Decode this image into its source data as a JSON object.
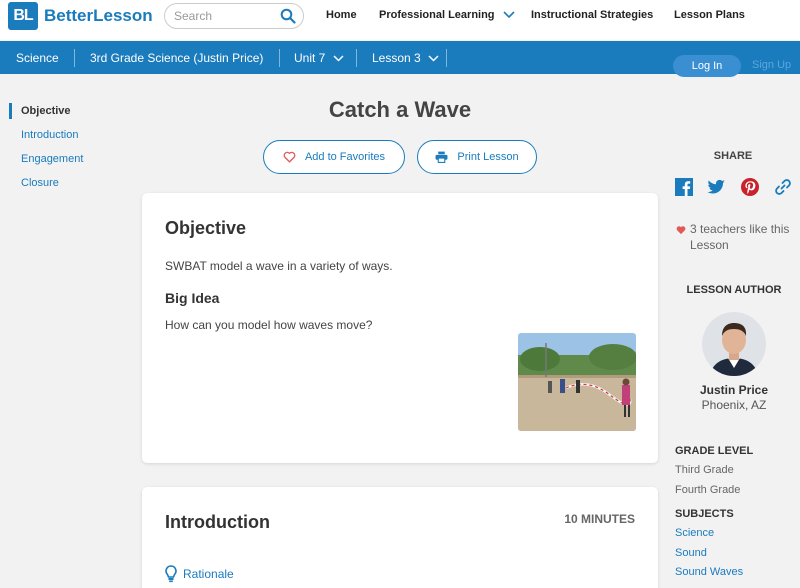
{
  "header": {
    "logo_mark": "BL",
    "logo_text": "BetterLesson",
    "search_placeholder": "Search",
    "nav": [
      {
        "label": "Home"
      },
      {
        "label": "Professional Learning",
        "icon": "chevron-down-icon"
      },
      {
        "label": "Instructional Strategies"
      },
      {
        "label": "Lesson Plans"
      }
    ]
  },
  "breadcrumb": [
    {
      "label": "Science"
    },
    {
      "label": "3rd Grade Science (Justin Price)"
    },
    {
      "label": "Unit 7",
      "icon": "chevron-down-icon"
    },
    {
      "label": "Lesson 3",
      "icon": "chevron-down-icon"
    }
  ],
  "auth": {
    "login_label": "Log In",
    "signup_label": "Sign Up"
  },
  "toc": [
    "Objective",
    "Introduction",
    "Engagement",
    "Closure"
  ],
  "toc_active": "Objective",
  "lesson": {
    "title": "Catch a Wave",
    "favorite_label": "Add to Favorites",
    "print_label": "Print Lesson",
    "objective_heading": "Objective",
    "objective_text": "SWBAT model a wave in a variety of ways.",
    "big_idea_heading": "Big Idea",
    "big_idea_text": "How can you model how waves move?",
    "intro_heading": "Introduction",
    "intro_minutes": "10 MINUTES",
    "rationale_label": "Rationale"
  },
  "sidebar": {
    "share_label": "SHARE",
    "share_icons": [
      "facebook-icon",
      "twitter-icon",
      "pinterest-icon",
      "link-icon"
    ],
    "likes_line1": "3 teachers like this",
    "likes_line2": "Lesson",
    "author_label": "LESSON AUTHOR",
    "author_name": "Justin Price",
    "author_location": "Phoenix, AZ",
    "grade_heading": "GRADE LEVEL",
    "grades": [
      "Third Grade",
      "Fourth Grade"
    ],
    "subjects_heading": "SUBJECTS",
    "subjects": [
      "Science",
      "Sound",
      "Sound Waves"
    ]
  },
  "colors": {
    "brand": "#1a7bbd",
    "heart": "#e05a5a"
  }
}
